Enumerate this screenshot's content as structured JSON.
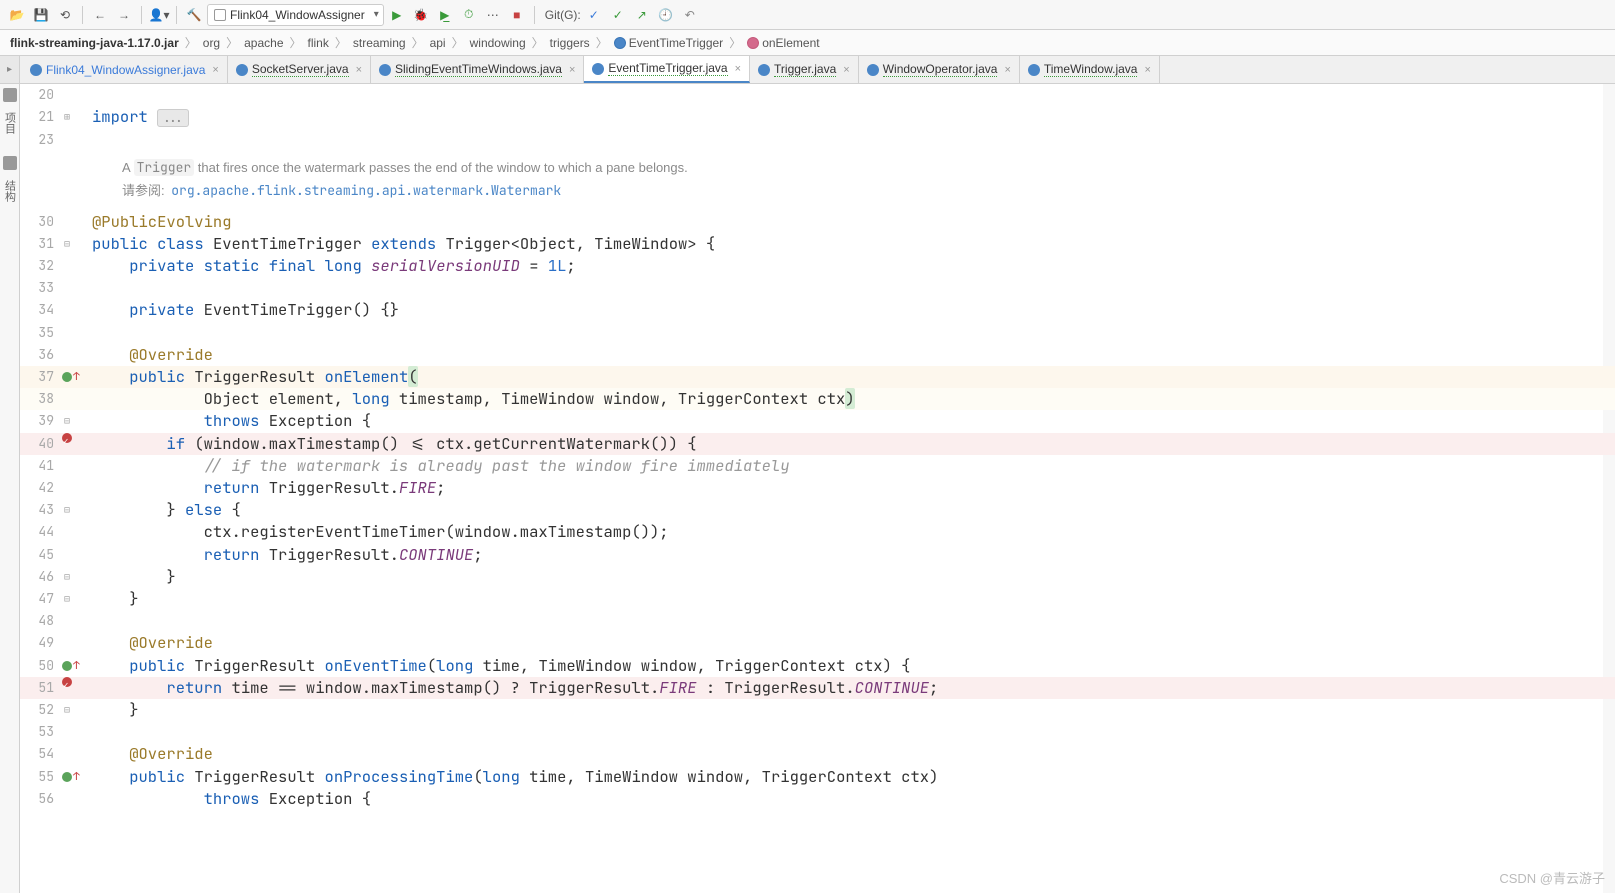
{
  "toolbar": {
    "run_config": "Flink04_WindowAssigner",
    "git_label": "Git(G):"
  },
  "breadcrumb": {
    "items": [
      {
        "label": "flink-streaming-java-1.17.0.jar",
        "strong": true
      },
      {
        "label": "org"
      },
      {
        "label": "apache"
      },
      {
        "label": "flink"
      },
      {
        "label": "streaming"
      },
      {
        "label": "api"
      },
      {
        "label": "windowing"
      },
      {
        "label": "triggers"
      },
      {
        "label": "EventTimeTrigger",
        "icon": "class"
      },
      {
        "label": "onElement",
        "icon": "method"
      }
    ]
  },
  "tabs": [
    {
      "label": "Flink04_WindowAssigner.java",
      "link": true
    },
    {
      "label": "SocketServer.java",
      "under": true
    },
    {
      "label": "SlidingEventTimeWindows.java",
      "under": true
    },
    {
      "label": "EventTimeTrigger.java",
      "under": true,
      "active": true
    },
    {
      "label": "Trigger.java",
      "under": true
    },
    {
      "label": "WindowOperator.java",
      "under": true
    },
    {
      "label": "TimeWindow.java",
      "under": true
    }
  ],
  "side_tools": {
    "label1": "项目",
    "label2": "结构"
  },
  "doc": {
    "text_a": "A ",
    "trigger": "Trigger",
    "text_b": " that fires once the watermark passes the end of the window to which a pane belongs.",
    "see_prefix": "请参阅: ",
    "see_link": "org.apache.flink.streaming.api.watermark.Watermark"
  },
  "code": {
    "l20": "",
    "l21_import": "import ",
    "l21_dots": "...",
    "l23": "",
    "l30": "@PublicEvolving",
    "l31_a": "public",
    "l31_b": "class",
    "l31_c": "EventTimeTrigger",
    "l31_d": "extends",
    "l31_e": "Trigger<Object, TimeWindow> {",
    "l32_a": "private",
    "l32_b": "static",
    "l32_c": "final",
    "l32_d": "long",
    "l32_e": "serialVersionUID",
    "l32_f": " = ",
    "l32_g": "1L",
    "l32_h": ";",
    "l33": "",
    "l34_a": "private",
    "l34_b": "EventTimeTrigger",
    "l34_c": "() {}",
    "l35": "",
    "l36": "@Override",
    "l37_a": "public",
    "l37_b": "TriggerResult",
    "l37_c": "onElement",
    "l37_d": "(",
    "l38_a": "Object element, ",
    "l38_b": "long",
    "l38_c": " timestamp, TimeWindow window, TriggerContext ctx",
    "l38_d": ")",
    "l39_a": "throws",
    "l39_b": " Exception {",
    "l40_a": "if",
    "l40_b": " (window.maxTimestamp() <= ctx.getCurrentWatermark()) {",
    "l41": "// if the watermark is already past the window fire immediately",
    "l42_a": "return",
    "l42_b": " TriggerResult.",
    "l42_c": "FIRE",
    "l42_d": ";",
    "l43_a": "} ",
    "l43_b": "else",
    "l43_c": " {",
    "l44": "ctx.registerEventTimeTimer(window.maxTimestamp());",
    "l45_a": "return",
    "l45_b": " TriggerResult.",
    "l45_c": "CONTINUE",
    "l45_d": ";",
    "l46": "}",
    "l47": "}",
    "l48": "",
    "l49": "@Override",
    "l50_a": "public",
    "l50_b": "TriggerResult",
    "l50_c": "onEventTime",
    "l50_d": "(",
    "l50_e": "long",
    "l50_f": " time, TimeWindow window, TriggerContext ctx) {",
    "l51_a": "return",
    "l51_b": " time == window.maxTimestamp() ? TriggerResult.",
    "l51_c": "FIRE",
    "l51_d": " : TriggerResult.",
    "l51_e": "CONTINUE",
    "l51_f": ";",
    "l52": "}",
    "l53": "",
    "l54": "@Override",
    "l55_a": "public",
    "l55_b": "TriggerResult",
    "l55_c": "onProcessingTime",
    "l55_d": "(",
    "l55_e": "long",
    "l55_f": " time, TimeWindow window, TriggerContext ctx)",
    "l56_a": "throws",
    "l56_b": " Exception {"
  },
  "line_numbers": [
    "20",
    "21",
    "23",
    "30",
    "31",
    "32",
    "33",
    "34",
    "35",
    "36",
    "37",
    "38",
    "39",
    "40",
    "41",
    "42",
    "43",
    "44",
    "45",
    "46",
    "47",
    "48",
    "49",
    "50",
    "51",
    "52",
    "53",
    "54",
    "55",
    "56"
  ],
  "watermark": "CSDN @青云游子"
}
